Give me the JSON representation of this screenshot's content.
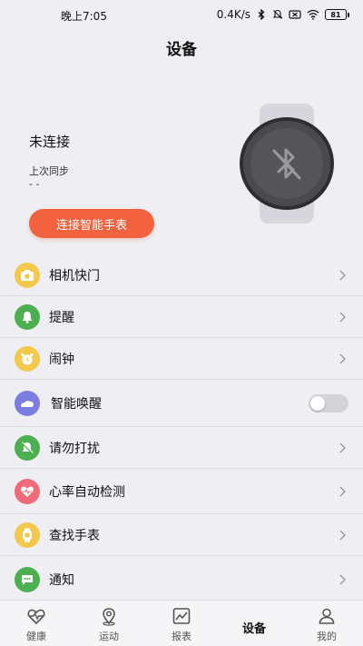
{
  "status_bar": {
    "time": "晚上7:05",
    "net_speed": "0.4K/s",
    "battery": "81"
  },
  "page_title": "设备",
  "device": {
    "connection_status": "未连接",
    "last_sync_label": "上次同步",
    "last_sync_value": "- -",
    "connect_button": "连接智能手表"
  },
  "menu": {
    "items": [
      {
        "label": "相机快门",
        "icon": "camera-icon",
        "color": "#f2c94c"
      },
      {
        "label": "提醒",
        "icon": "bell-icon",
        "color": "#4caf50"
      },
      {
        "label": "闹钟",
        "icon": "alarm-clock-icon",
        "color": "#f2c94c"
      },
      {
        "label": "智能唤醒",
        "icon": "smart-wake-icon",
        "color": "#7b7ee0",
        "toggle": false
      },
      {
        "label": "请勿打扰",
        "icon": "do-not-disturb-icon",
        "color": "#4caf50"
      },
      {
        "label": "心率自动检测",
        "icon": "heart-rate-icon",
        "color": "#ef6b7a"
      },
      {
        "label": "查找手表",
        "icon": "find-watch-icon",
        "color": "#f2c94c"
      },
      {
        "label": "通知",
        "icon": "notification-icon",
        "color": "#4caf50"
      }
    ]
  },
  "tabs": [
    {
      "label": "健康",
      "icon": "heartbeat-icon"
    },
    {
      "label": "运动",
      "icon": "location-pin-icon"
    },
    {
      "label": "报表",
      "icon": "report-chart-icon"
    },
    {
      "label": "设备",
      "icon": "device-icon",
      "active": true
    },
    {
      "label": "我的",
      "icon": "profile-icon"
    }
  ],
  "colors": {
    "accent": "#f2623f",
    "background": "#efeff3"
  }
}
